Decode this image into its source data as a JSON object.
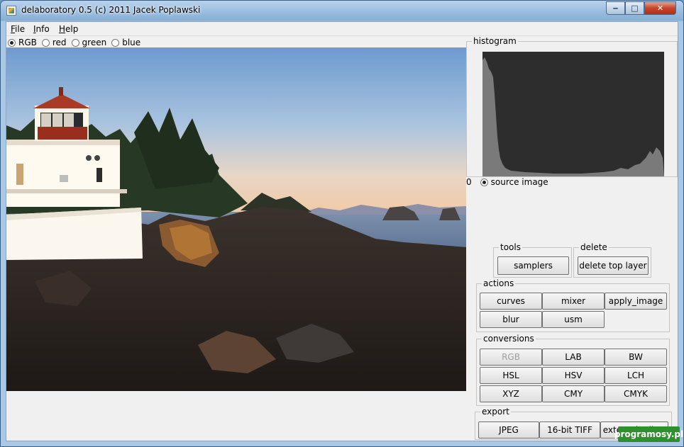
{
  "window": {
    "title": "delaboratory 0.5 (c) 2011 Jacek Poplawski",
    "minimize_glyph": "‒",
    "maximize_glyph": "□",
    "close_glyph": "✕"
  },
  "menu": [
    "File",
    "Info",
    "Help"
  ],
  "channels": {
    "options": [
      "RGB",
      "red",
      "green",
      "blue"
    ],
    "selected": "RGB"
  },
  "histogram": {
    "title": "histogram",
    "min_label": "0",
    "source_label": "source image",
    "source_selected": true
  },
  "tools": {
    "title": "tools",
    "samplers": "samplers"
  },
  "delete": {
    "title": "delete",
    "delete_top_layer": "delete top layer"
  },
  "actions": {
    "title": "actions",
    "buttons": [
      "curves",
      "mixer",
      "apply_image",
      "blur",
      "usm"
    ]
  },
  "conversions": {
    "title": "conversions",
    "buttons": [
      "RGB",
      "LAB",
      "BW",
      "HSL",
      "HSV",
      "LCH",
      "XYZ",
      "CMY",
      "CMYK"
    ],
    "disabled": "RGB"
  },
  "export": {
    "title": "export",
    "buttons": [
      "JPEG",
      "16-bit TIFF",
      "external editor"
    ]
  },
  "watermark": "programosy.pl",
  "colors": {
    "histogram_bg": "#2d2d2d",
    "histogram_fill": "#7a7a7a",
    "watermark_bg": "#2f8f2f"
  }
}
